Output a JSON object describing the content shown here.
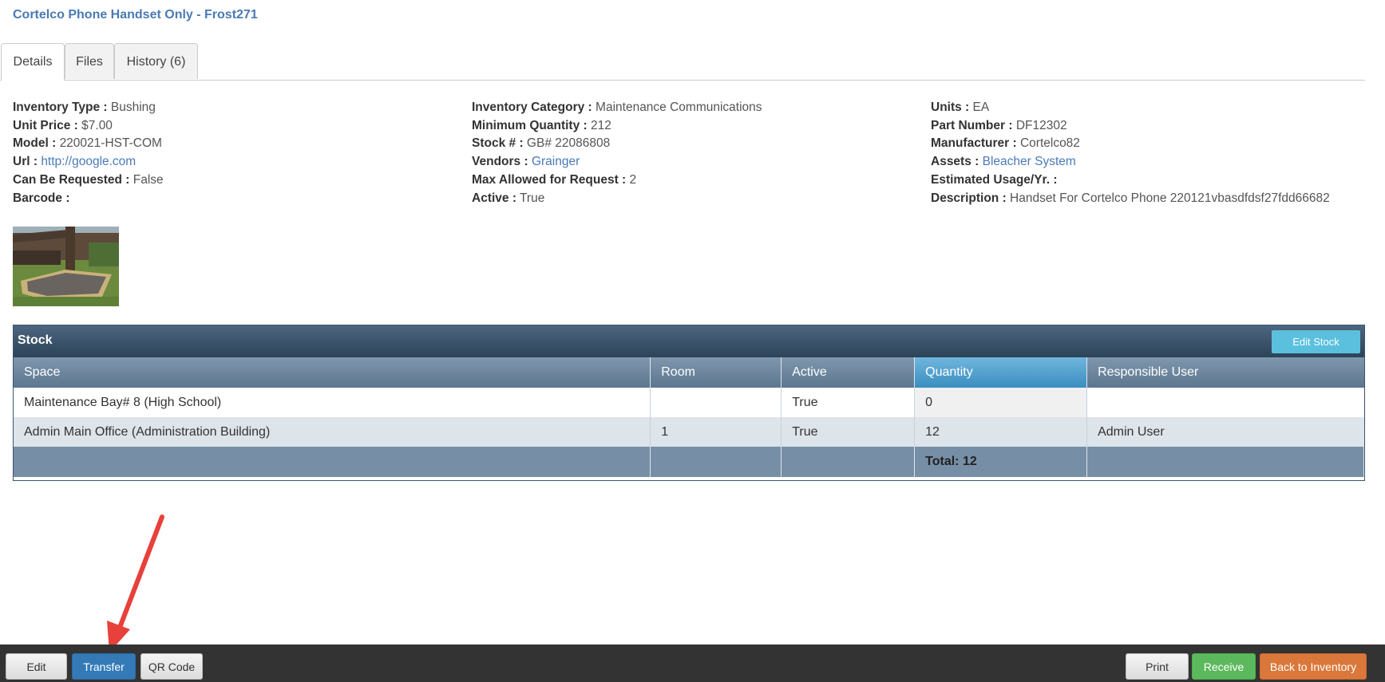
{
  "page": {
    "title": "Cortelco Phone Handset Only - Frost271"
  },
  "tabs": [
    {
      "label": "Details",
      "active": true
    },
    {
      "label": "Files",
      "active": false
    },
    {
      "label": "History (6)",
      "active": false
    }
  ],
  "details": {
    "inventory_type": {
      "label": "Inventory Type :",
      "value": "Bushing"
    },
    "unit_price": {
      "label": "Unit Price :",
      "value": "$7.00"
    },
    "model": {
      "label": "Model :",
      "value": "220021-HST-COM"
    },
    "url": {
      "label": "Url :",
      "value": "http://google.com"
    },
    "can_be_requested": {
      "label": "Can Be Requested :",
      "value": "False"
    },
    "barcode": {
      "label": "Barcode :",
      "value": ""
    },
    "inventory_category": {
      "label": "Inventory Category :",
      "value": "Maintenance Communications"
    },
    "minimum_quantity": {
      "label": "Minimum Quantity :",
      "value": "212"
    },
    "stock_number": {
      "label": "Stock # :",
      "value": "GB# 22086808"
    },
    "vendors": {
      "label": "Vendors :",
      "value": "Grainger"
    },
    "max_allowed": {
      "label": "Max Allowed for Request :",
      "value": "2"
    },
    "active": {
      "label": "Active :",
      "value": "True"
    },
    "units": {
      "label": "Units :",
      "value": "EA"
    },
    "part_number": {
      "label": "Part Number :",
      "value": "DF12302"
    },
    "manufacturer": {
      "label": "Manufacturer :",
      "value": "Cortelco82"
    },
    "assets": {
      "label": "Assets :",
      "value": "Bleacher System"
    },
    "estimated_usage": {
      "label": "Estimated Usage/Yr. :",
      "value": ""
    },
    "description": {
      "label": "Description :",
      "value": "Handset For Cortelco Phone 220121vbasdfdsf27fdd66682"
    }
  },
  "stock": {
    "title": "Stock",
    "edit_button": "Edit Stock",
    "columns": [
      "Space",
      "Room",
      "Active",
      "Quantity",
      "Responsible User"
    ],
    "rows": [
      [
        "Maintenance Bay# 8 (High School)",
        "",
        "True",
        "0",
        ""
      ],
      [
        "Admin Main Office (Administration Building)",
        "1",
        "True",
        "12",
        "Admin User"
      ]
    ],
    "total": "Total: 12"
  },
  "toolbar": {
    "edit": "Edit",
    "transfer": "Transfer",
    "qr_code": "QR Code",
    "print": "Print",
    "receive": "Receive",
    "back": "Back to Inventory"
  },
  "colors": {
    "title_blue": "#4a7ab5",
    "header_dark": "#2c4358",
    "sorted_header": "#3a8ec0",
    "toolbar_bg": "#333333",
    "annotation_arrow": "#e8403a"
  },
  "icons": {
    "annotation": "red-arrow-icon",
    "thumbnail": "inventory-photo"
  }
}
